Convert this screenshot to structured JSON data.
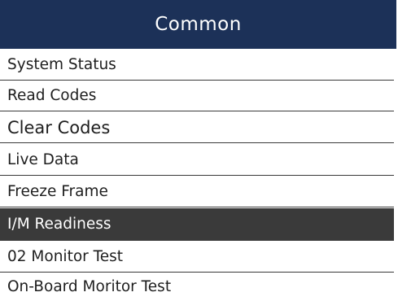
{
  "header": {
    "title": "Common"
  },
  "menu": {
    "items": [
      {
        "label": "System Status"
      },
      {
        "label": "Read Codes"
      },
      {
        "label": "Clear Codes"
      },
      {
        "label": "Live Data"
      },
      {
        "label": "Freeze Frame"
      },
      {
        "label": "I/M Readiness"
      },
      {
        "label": "02 Monitor Test"
      },
      {
        "label": "On-Board Moritor Test"
      }
    ],
    "selected_label": "I/M Readiness"
  },
  "colors": {
    "header_bg": "#1c3158",
    "selected_bg": "#3a3a3a",
    "text": "#1e1e1e"
  }
}
